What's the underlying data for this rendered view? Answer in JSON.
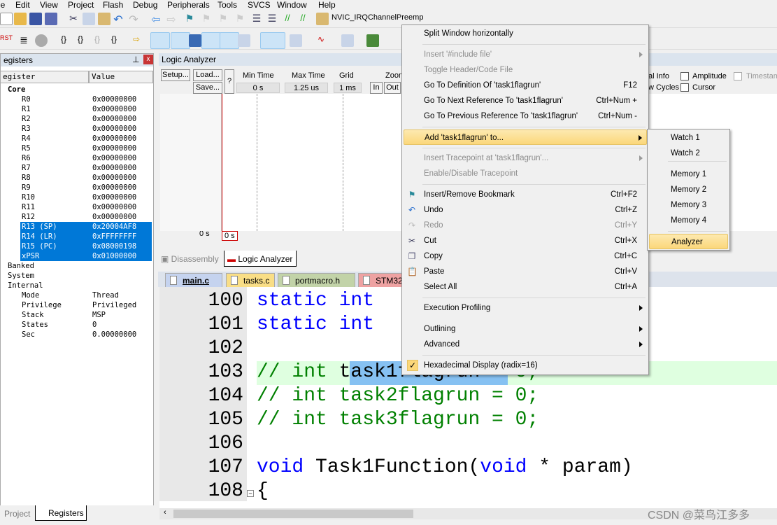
{
  "menubar": [
    "le",
    "Edit",
    "View",
    "Project",
    "Flash",
    "Debug",
    "Peripherals",
    "Tools",
    "SVCS",
    "Window",
    "Help"
  ],
  "toolbar": {
    "combo_value": "NVIC_IRQChannelPreemp"
  },
  "registers": {
    "title": "egisters",
    "col_register": "egister",
    "col_value": "Value",
    "groups": {
      "core": "Core",
      "banked": "Banked",
      "system": "System",
      "internal": "Internal"
    },
    "core": [
      [
        "R0",
        "0x00000000"
      ],
      [
        "R1",
        "0x00000000"
      ],
      [
        "R2",
        "0x00000000"
      ],
      [
        "R3",
        "0x00000000"
      ],
      [
        "R4",
        "0x00000000"
      ],
      [
        "R5",
        "0x00000000"
      ],
      [
        "R6",
        "0x00000000"
      ],
      [
        "R7",
        "0x00000000"
      ],
      [
        "R8",
        "0x00000000"
      ],
      [
        "R9",
        "0x00000000"
      ],
      [
        "R10",
        "0x00000000"
      ],
      [
        "R11",
        "0x00000000"
      ],
      [
        "R12",
        "0x00000000"
      ],
      [
        "R13 (SP)",
        "0x20004AF8"
      ],
      [
        "R14 (LR)",
        "0xFFFFFFFF"
      ],
      [
        "R15 (PC)",
        "0x08000198"
      ],
      [
        "xPSR",
        "0x01000000"
      ]
    ],
    "internal": [
      [
        "Mode",
        "Thread"
      ],
      [
        "Privilege",
        "Privileged"
      ],
      [
        "Stack",
        "MSP"
      ],
      [
        "States",
        "0"
      ],
      [
        "Sec",
        "0.00000000"
      ]
    ]
  },
  "bottom_tabs": {
    "project": "Project",
    "registers": "Registers"
  },
  "logic_analyzer": {
    "title": "Logic Analyzer",
    "setup": "Setup...",
    "load": "Load...",
    "save": "Save...",
    "help": "?",
    "min_time_label": "Min Time",
    "min_time": "0 s",
    "max_time_label": "Max Time",
    "max_time": "1.25 us",
    "grid_label": "Grid",
    "grid": "1 ms",
    "zoom_label": "Zoom",
    "zoom_in": "In",
    "zoom_out": "Out",
    "signal_info": "al Info",
    "show_cycles": "w Cycles",
    "amplitude": "Amplitude",
    "cursor": "Cursor",
    "timestamps": "Timestam",
    "time_left": "0 s",
    "time_cursor": "0 s"
  },
  "view_tabs": {
    "disassembly": "Disassembly",
    "logic_analyzer": "Logic Analyzer"
  },
  "file_tabs": [
    {
      "name": "main.c",
      "color": "#c5d3ef"
    },
    {
      "name": "tasks.c",
      "color": "#f9de86"
    },
    {
      "name": "portmacro.h",
      "color": "#c2d3a8"
    },
    {
      "name": "STM32F",
      "color": "#eea2a2"
    }
  ],
  "editor": {
    "lines": [
      "100",
      "101",
      "102",
      "103",
      "104",
      "105",
      "106",
      "107",
      "108"
    ]
  },
  "context_menu": [
    {
      "label": "Split Window horizontally"
    },
    {
      "label": "Insert '#include file'",
      "disabled": true,
      "submenu": true
    },
    {
      "label": "Toggle Header/Code File",
      "disabled": true
    },
    {
      "label": "Go To Definition Of 'task1flagrun'",
      "shortcut": "F12"
    },
    {
      "label": "Go To Next Reference To 'task1flagrun'",
      "shortcut": "Ctrl+Num +"
    },
    {
      "label": "Go To Previous Reference To 'task1flagrun'",
      "shortcut": "Ctrl+Num -"
    },
    {
      "label": "Add 'task1flagrun' to...",
      "submenu": true,
      "highlighted": true
    },
    {
      "label": "Insert Tracepoint at 'task1flagrun'...",
      "disabled": true,
      "submenu": true
    },
    {
      "label": "Enable/Disable Tracepoint",
      "disabled": true
    },
    {
      "label": "Insert/Remove Bookmark",
      "shortcut": "Ctrl+F2",
      "icon": "bookmark-flag-icon"
    },
    {
      "label": "Undo",
      "shortcut": "Ctrl+Z",
      "icon": "undo-icon"
    },
    {
      "label": "Redo",
      "shortcut": "Ctrl+Y",
      "disabled": true,
      "icon": "redo-icon"
    },
    {
      "label": "Cut",
      "shortcut": "Ctrl+X",
      "icon": "scissors-icon"
    },
    {
      "label": "Copy",
      "shortcut": "Ctrl+C",
      "icon": "copy-icon"
    },
    {
      "label": "Paste",
      "shortcut": "Ctrl+V",
      "icon": "paste-icon"
    },
    {
      "label": "Select All",
      "shortcut": "Ctrl+A"
    },
    {
      "label": "Execution Profiling",
      "submenu": true
    },
    {
      "label": "Outlining",
      "submenu": true
    },
    {
      "label": "Advanced",
      "submenu": true
    },
    {
      "label": "Hexadecimal Display (radix=16)",
      "checked": true
    }
  ],
  "submenu": [
    {
      "label": "Watch 1"
    },
    {
      "label": "Watch 2"
    },
    {
      "label": "Memory 1"
    },
    {
      "label": "Memory 2"
    },
    {
      "label": "Memory 3"
    },
    {
      "label": "Memory 4"
    },
    {
      "label": "Analyzer",
      "highlighted": true
    }
  ],
  "watermark": "CSDN @菜鸟江多多",
  "colors": {
    "selection": "#0078d7",
    "menu_highlight": "#fbd77a",
    "keyword": "#0000ff",
    "comment": "#008000"
  }
}
